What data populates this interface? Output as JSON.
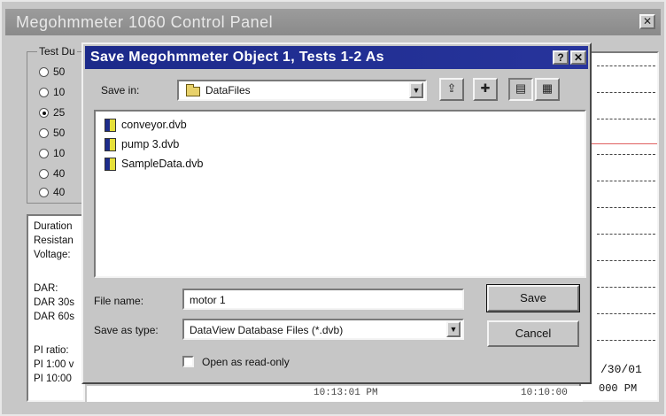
{
  "parent": {
    "title": "Megohmmeter 1060 Control Panel",
    "close_icon": "✕",
    "test_group_label": "Test Du",
    "radio_options": [
      "50",
      "10",
      "25",
      "50",
      "10",
      "40",
      "40"
    ],
    "results_lines": [
      "Duration",
      "Resistan",
      "Voltage:",
      "DAR:",
      "DAR 30s",
      "DAR 60s",
      "PI ratio:",
      "PI 1:00 v",
      "PI 10:00"
    ],
    "graph_date": "/30/01",
    "graph_time": "000 PM",
    "bottom_time_a": "10:13:01 PM",
    "bottom_time_b": "10:10:00"
  },
  "dialog": {
    "title": "Save Megohmmeter Object 1, Tests 1-2 As",
    "help_btn": "?",
    "close_btn": "✕",
    "save_in_label": "Save in:",
    "save_in_value": "DataFiles",
    "files": [
      "conveyor.dvb",
      "pump 3.dvb",
      "SampleData.dvb"
    ],
    "file_name_label": "File name:",
    "file_name_value": "motor 1",
    "save_as_type_label": "Save as type:",
    "save_as_type_value": "DataView Database Files (*.dvb)",
    "save_button": "Save",
    "cancel_button": "Cancel",
    "readonly_label": "Open as read-only"
  },
  "icons": [
    "folder-icon",
    "up-folder-icon",
    "new-folder-icon",
    "list-view-icon",
    "details-view-icon",
    "dropdown-arrow-icon",
    "help-icon",
    "close-icon"
  ],
  "colors": {
    "dialog_title_bar": "#1c2a8a",
    "window_face": "#c6c6c6",
    "graph_line": "#e06060"
  }
}
